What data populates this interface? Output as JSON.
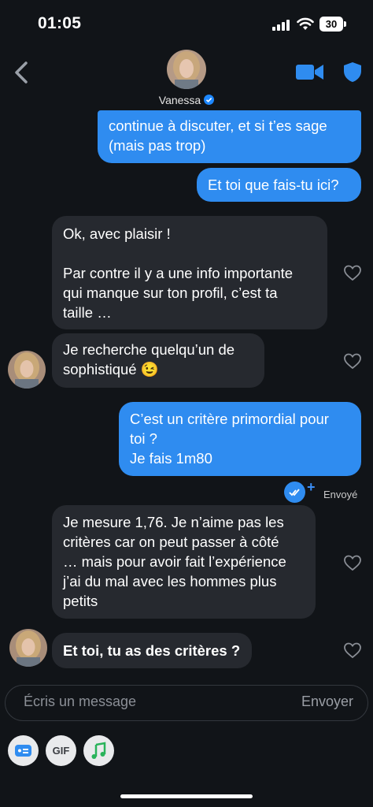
{
  "status": {
    "time": "01:05",
    "battery": "30"
  },
  "header": {
    "name": "Vanessa",
    "back_icon": "chevron-left-icon",
    "video_icon": "video-camera-icon",
    "shield_icon": "shield-icon",
    "accent": "#2f8cf0"
  },
  "messages": {
    "m1": "continue à discuter, et si t’es sage\n(mais pas trop)",
    "m2": "Et toi que fais-tu ici?",
    "m3": "Ok, avec plaisir !\n\nPar contre il y a une info importante\nqui manque sur ton profil, c’est ta\ntaille …",
    "m4": "Je recherche quelqu’un de\nsophistiqué 😉",
    "m5": "C’est un critère primordial pour\ntoi ?\nJe fais 1m80",
    "status_sent": "Envoyé",
    "m6": "Je mesure 1,76. Je n’aime pas les\ncritères car on peut passer à côté\n… mais pour avoir fait l’expérience\nj’ai du mal avec les hommes plus\npetits",
    "m7": "Et toi, tu as des critères ?"
  },
  "composer": {
    "placeholder": "Écris un message",
    "send_label": "Envoyer"
  },
  "tools": {
    "gif_label": "GIF"
  }
}
